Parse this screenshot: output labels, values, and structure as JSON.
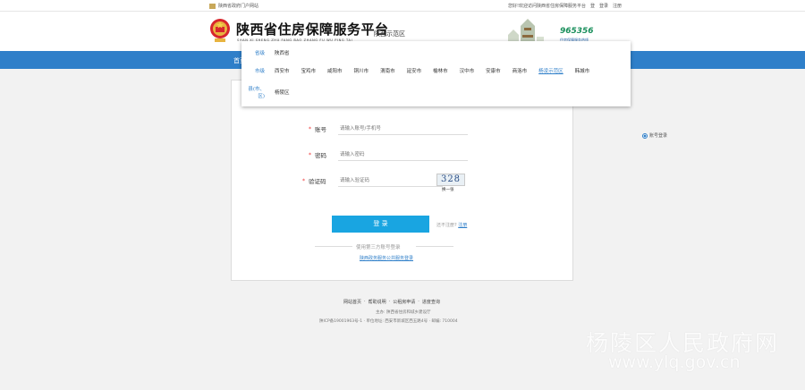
{
  "topbar": {
    "left_text": "陕西省政府门户网站",
    "right_links": [
      "您好!欢迎访问陕西省住房保障服务平台",
      "登",
      "登录",
      "注册"
    ]
  },
  "header": {
    "title": "陕西省住房保障服务平台",
    "pinyin": "SHAN XI SHENG ZHU FANG BAO ZHANG FU WU PING TAI",
    "city_switch": "陕西示范区",
    "hotline": "965356",
    "hotline_sub": "住房保障服务热线"
  },
  "nav": {
    "first_item": "首页"
  },
  "dropdown": {
    "row1": {
      "label": "省级",
      "items": [
        "陕西省"
      ]
    },
    "row2": {
      "label": "市级",
      "items": [
        "西安市",
        "宝鸡市",
        "咸阳市",
        "铜川市",
        "渭南市",
        "延安市",
        "榆林市",
        "汉中市",
        "安康市",
        "商洛市",
        "杨凌示范区",
        "韩城市"
      ],
      "active_index": 10
    },
    "row3": {
      "label": "县(市、区)",
      "items": [
        "杨陵区"
      ]
    }
  },
  "form": {
    "account_label": "账号",
    "account_placeholder": "请输入账号/手机号",
    "password_label": "密码",
    "password_placeholder": "请输入密码",
    "captcha_label": "验证码",
    "captcha_placeholder": "请输入验证码",
    "captcha_text": "328",
    "captcha_refresh": "换一张",
    "login_button": "登 录",
    "register_hint": "还不注册?",
    "register_link": "注册",
    "third_party": "使用第三方账号登录",
    "app_link": "陕西政务服务公共服务登录",
    "remember": "账号登录"
  },
  "footer": {
    "links": [
      "网站首页",
      "·",
      "帮助说明",
      "·",
      "公租房申请",
      "·",
      "进度查询"
    ],
    "line1": "主办: 陕西省住房和城乡建设厅",
    "line2": "陕ICP备19001963号-1 · 单位地址: 西安市新城区西五路4号 · 邮编: 710004"
  },
  "watermark": {
    "line1": "杨陵区人民政府网",
    "line2": "www.ylq.gov.cn"
  },
  "colors": {
    "brand_blue": "#2f7fc9",
    "button_blue": "#19a5e1",
    "hotline_green": "#1a8f5c"
  }
}
